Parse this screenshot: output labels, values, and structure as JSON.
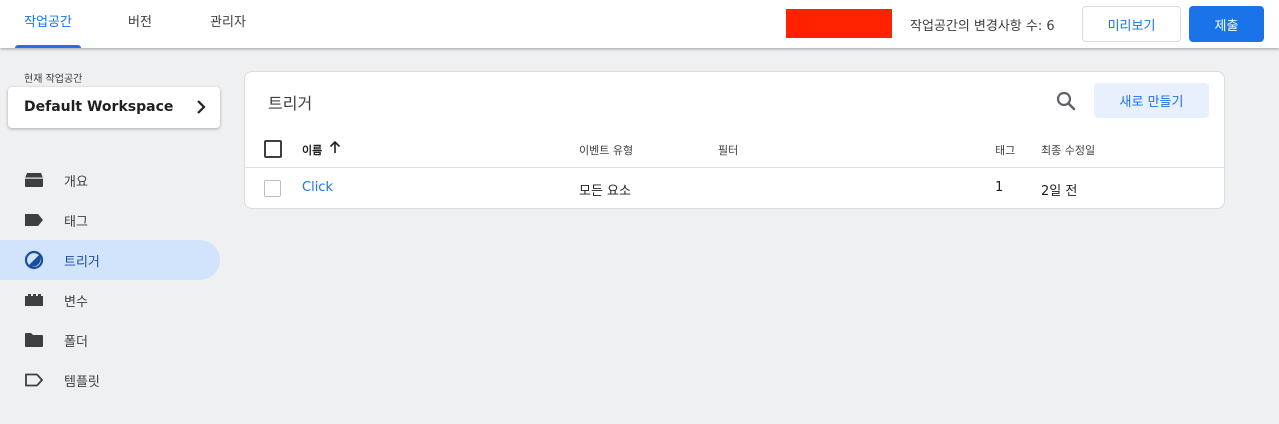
{
  "topbar": {
    "tabs": [
      {
        "label": "작업공간",
        "active": true
      },
      {
        "label": "버전",
        "active": false
      },
      {
        "label": "관리자",
        "active": false
      }
    ],
    "changes_text": "작업공간의 변경사항 수: 6",
    "preview_label": "미리보기",
    "submit_label": "제출",
    "redacted_color": "#ff2200"
  },
  "sidebar": {
    "current_workspace_label": "현재 작업공간",
    "workspace_name": "Default Workspace",
    "items": [
      {
        "label": "개요",
        "icon": "overview-icon",
        "active": false
      },
      {
        "label": "태그",
        "icon": "tag-icon",
        "active": false
      },
      {
        "label": "트리거",
        "icon": "trigger-icon",
        "active": true
      },
      {
        "label": "변수",
        "icon": "variable-icon",
        "active": false
      },
      {
        "label": "폴더",
        "icon": "folder-icon",
        "active": false
      },
      {
        "label": "템플릿",
        "icon": "template-icon",
        "active": false
      }
    ]
  },
  "main": {
    "title": "트리거",
    "new_button_label": "새로 만들기",
    "columns": [
      "이름",
      "이벤트 유형",
      "필터",
      "태그",
      "최종 수정일"
    ],
    "rows": [
      {
        "name": "Click",
        "event_type": "모든 요소",
        "filter": "",
        "tags": "1",
        "modified": "2일 전"
      }
    ]
  },
  "colors": {
    "accent": "#1a73e8",
    "active_nav_bg": "#d2e3fc",
    "page_bg": "#eff0f2"
  }
}
